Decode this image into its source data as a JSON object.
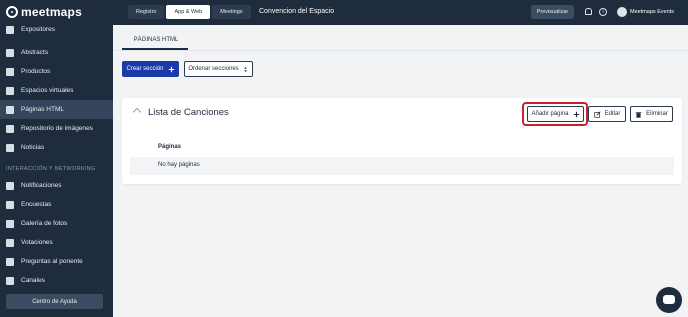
{
  "brand": {
    "logo_text": "meetmaps"
  },
  "sidebar": {
    "items": [
      {
        "label": "Expositores",
        "icon": "building-icon"
      },
      {
        "label": "Abstracts",
        "icon": "bookmark-icon"
      },
      {
        "label": "Productos",
        "icon": "box-icon"
      },
      {
        "label": "Espacios virtuales",
        "icon": "folder-icon"
      },
      {
        "label": "Páginas HTML",
        "icon": "book-icon",
        "active": true
      },
      {
        "label": "Repositorio de imágenes",
        "icon": "images-icon"
      },
      {
        "label": "Noticias",
        "icon": "file-icon"
      }
    ],
    "section_label": "INTERACCIÓN Y NETWORKING",
    "items2": [
      {
        "label": "Notificaciones",
        "icon": "bell-icon"
      },
      {
        "label": "Encuestas",
        "icon": "list-icon"
      },
      {
        "label": "Galería de fotos",
        "icon": "camera-icon"
      },
      {
        "label": "Votaciones",
        "icon": "chart-icon"
      },
      {
        "label": "Preguntas al ponente",
        "icon": "chat-icon"
      },
      {
        "label": "Canales",
        "icon": "hash-icon"
      }
    ],
    "help_label": "Centro de Ayuda"
  },
  "topbar": {
    "tabs": [
      "Registro",
      "App & Web",
      "Meetings"
    ],
    "active_tab": "App & Web",
    "event_title": "Convencion del Espacio",
    "preview_label": "Previsualizar",
    "user_name": "Meetmaps Events"
  },
  "main": {
    "subtab_label": "PÁGINAS HTML",
    "create_section_label": "Crear sección",
    "order_sections_label": "Ordenar secciones",
    "card": {
      "title": "Lista de Canciones",
      "add_page_label": "Añadir página",
      "edit_label": "Editar",
      "delete_label": "Eliminar",
      "table_header": "Páginas",
      "empty_text": "No hay páginas"
    }
  },
  "colors": {
    "sidebar_bg": "#1f2c3d",
    "primary": "#1a3aa8",
    "highlight": "#c8232c"
  }
}
